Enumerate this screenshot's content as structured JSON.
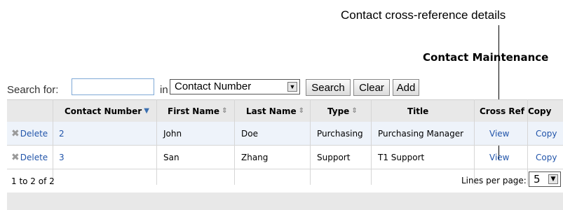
{
  "callout": {
    "text": "Contact cross-reference details"
  },
  "page_title": "Contact Maintenance",
  "search": {
    "label": "Search for:",
    "value": "",
    "in_label": "in",
    "field_selected": "Contact Number",
    "search_button": "Search",
    "clear_button": "Clear",
    "add_button": "Add"
  },
  "table": {
    "columns": [
      "Contact Number",
      "First Name",
      "Last Name",
      "Type",
      "Title",
      "Cross Ref",
      "Copy"
    ],
    "rows": [
      {
        "action": "Delete",
        "number": "2",
        "first": "John",
        "last": "Doe",
        "type": "Purchasing",
        "title": "Purchasing Manager",
        "xref": "View",
        "copy": "Copy"
      },
      {
        "action": "Delete",
        "number": "3",
        "first": "San",
        "last": "Zhang",
        "type": "Support",
        "title": "T1 Support",
        "xref": "View",
        "copy": "Copy"
      }
    ]
  },
  "footer": {
    "count": "1 to 2 of 2",
    "lines_label": "Lines per page:",
    "lines_value": "5"
  },
  "icons": {
    "sort_active": "chevron-down-icon",
    "sort": "sort-updown-icon",
    "delete": "delete-x-icon"
  },
  "colors": {
    "link": "#2255aa",
    "alt_row": "#eef3fa",
    "header_bg": "#e8e8e8"
  }
}
